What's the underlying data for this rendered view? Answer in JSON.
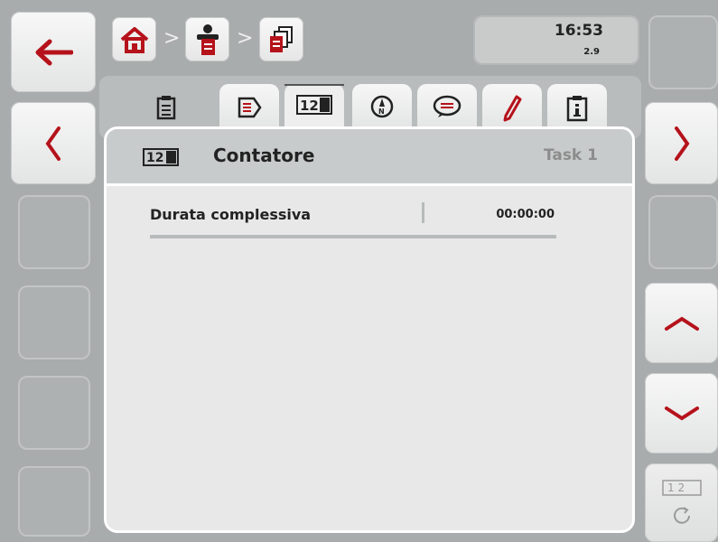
{
  "header": {
    "time": "16:53",
    "version": "2.9",
    "breadcrumb_separator": ">"
  },
  "tabs": [
    {
      "name": "tab-clipboard",
      "icon": "clipboard-icon",
      "state": "static"
    },
    {
      "name": "tab-field-data",
      "icon": "field-data-icon",
      "state": "normal"
    },
    {
      "name": "tab-counter",
      "icon": "counter-icon",
      "state": "active"
    },
    {
      "name": "tab-gps",
      "icon": "compass-icon",
      "state": "normal"
    },
    {
      "name": "tab-comments",
      "icon": "speech-bubble-icon",
      "state": "normal"
    },
    {
      "name": "tab-edit",
      "icon": "pencil-icon",
      "state": "normal"
    },
    {
      "name": "tab-info",
      "icon": "info-icon",
      "state": "normal"
    }
  ],
  "panel": {
    "title": "Contatore",
    "task": "Task 1",
    "icon_text": "12",
    "rows": [
      {
        "label": "Durata complessiva",
        "value": "00:00:00"
      }
    ]
  },
  "right_bottom_button": {
    "icon_text": "1 2"
  },
  "colors": {
    "icon_red": "#b5121b",
    "background": "#a9acac",
    "panel": "#e8e8e8"
  }
}
